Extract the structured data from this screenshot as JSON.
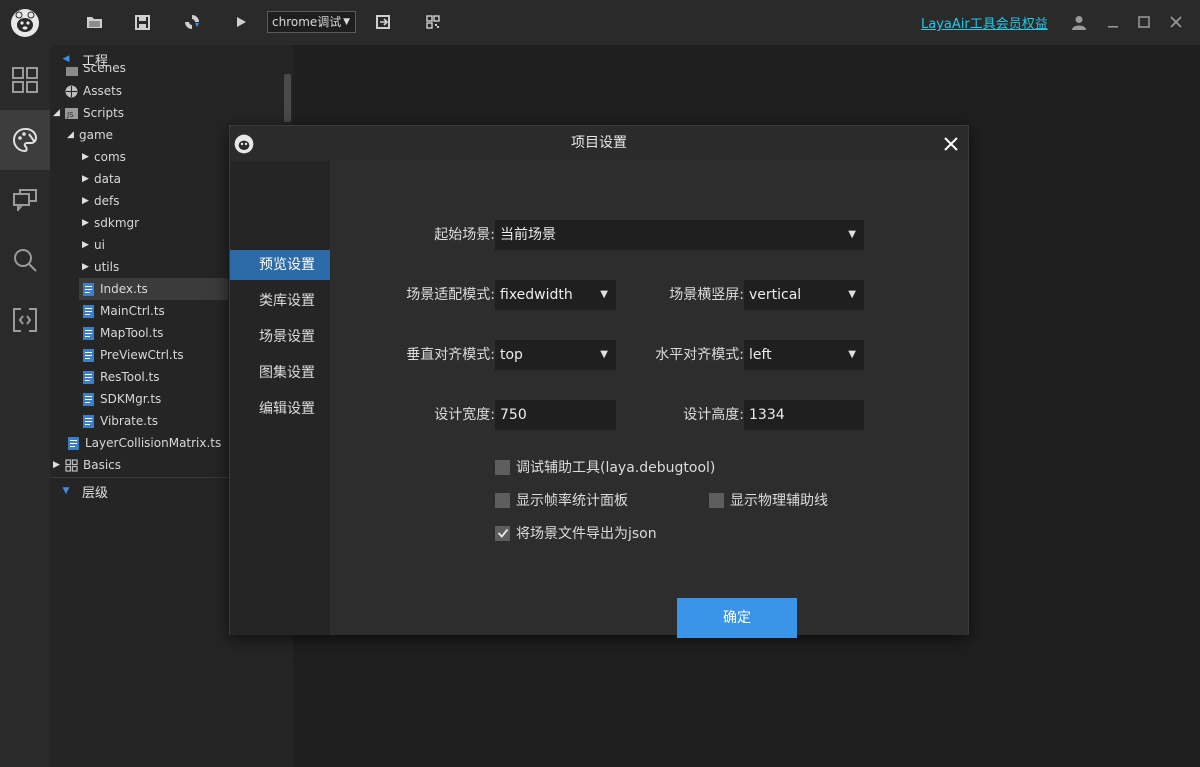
{
  "toolbar": {
    "run_target": "chrome调试",
    "member_link": "LayaAir工具会员权益"
  },
  "tree": {
    "project_header": "工程",
    "layers_header": "层级",
    "rows": [
      {
        "label": "Scenes"
      },
      {
        "label": "Assets"
      },
      {
        "label": "Scripts"
      },
      {
        "label": "game"
      },
      {
        "label": "coms"
      },
      {
        "label": "data"
      },
      {
        "label": "defs"
      },
      {
        "label": "sdkmgr"
      },
      {
        "label": "ui"
      },
      {
        "label": "utils"
      },
      {
        "label": "Index.ts"
      },
      {
        "label": "MainCtrl.ts"
      },
      {
        "label": "MapTool.ts"
      },
      {
        "label": "PreViewCtrl.ts"
      },
      {
        "label": "ResTool.ts"
      },
      {
        "label": "SDKMgr.ts"
      },
      {
        "label": "Vibrate.ts"
      },
      {
        "label": "LayerCollisionMatrix.ts"
      },
      {
        "label": "Basics"
      }
    ]
  },
  "dialog": {
    "title": "项目设置",
    "nav": [
      "预览设置",
      "类库设置",
      "场景设置",
      "图集设置",
      "编辑设置"
    ],
    "active_nav": "预览设置",
    "fields": {
      "start_scene_label": "起始场景:",
      "start_scene_value": "当前场景",
      "scale_mode_label": "场景适配模式:",
      "scale_mode_value": "fixedwidth",
      "screen_mode_label": "场景横竖屏:",
      "screen_mode_value": "vertical",
      "valign_label": "垂直对齐模式:",
      "valign_value": "top",
      "halign_label": "水平对齐模式:",
      "halign_value": "left",
      "width_label": "设计宽度:",
      "width_value": "750",
      "height_label": "设计高度:",
      "height_value": "1334"
    },
    "checkboxes": {
      "debugtool": {
        "label": "调试辅助工具(laya.debugtool)",
        "checked": false
      },
      "stat_panel": {
        "label": "显示帧率统计面板",
        "checked": false
      },
      "physics_debug": {
        "label": "显示物理辅助线",
        "checked": false
      },
      "export_json": {
        "label": "将场景文件导出为json",
        "checked": true
      }
    },
    "confirm_label": "确定"
  },
  "colors": {
    "accent": "#3a94e8",
    "nav_active": "#2d6aa8",
    "link": "#25c8e6"
  }
}
